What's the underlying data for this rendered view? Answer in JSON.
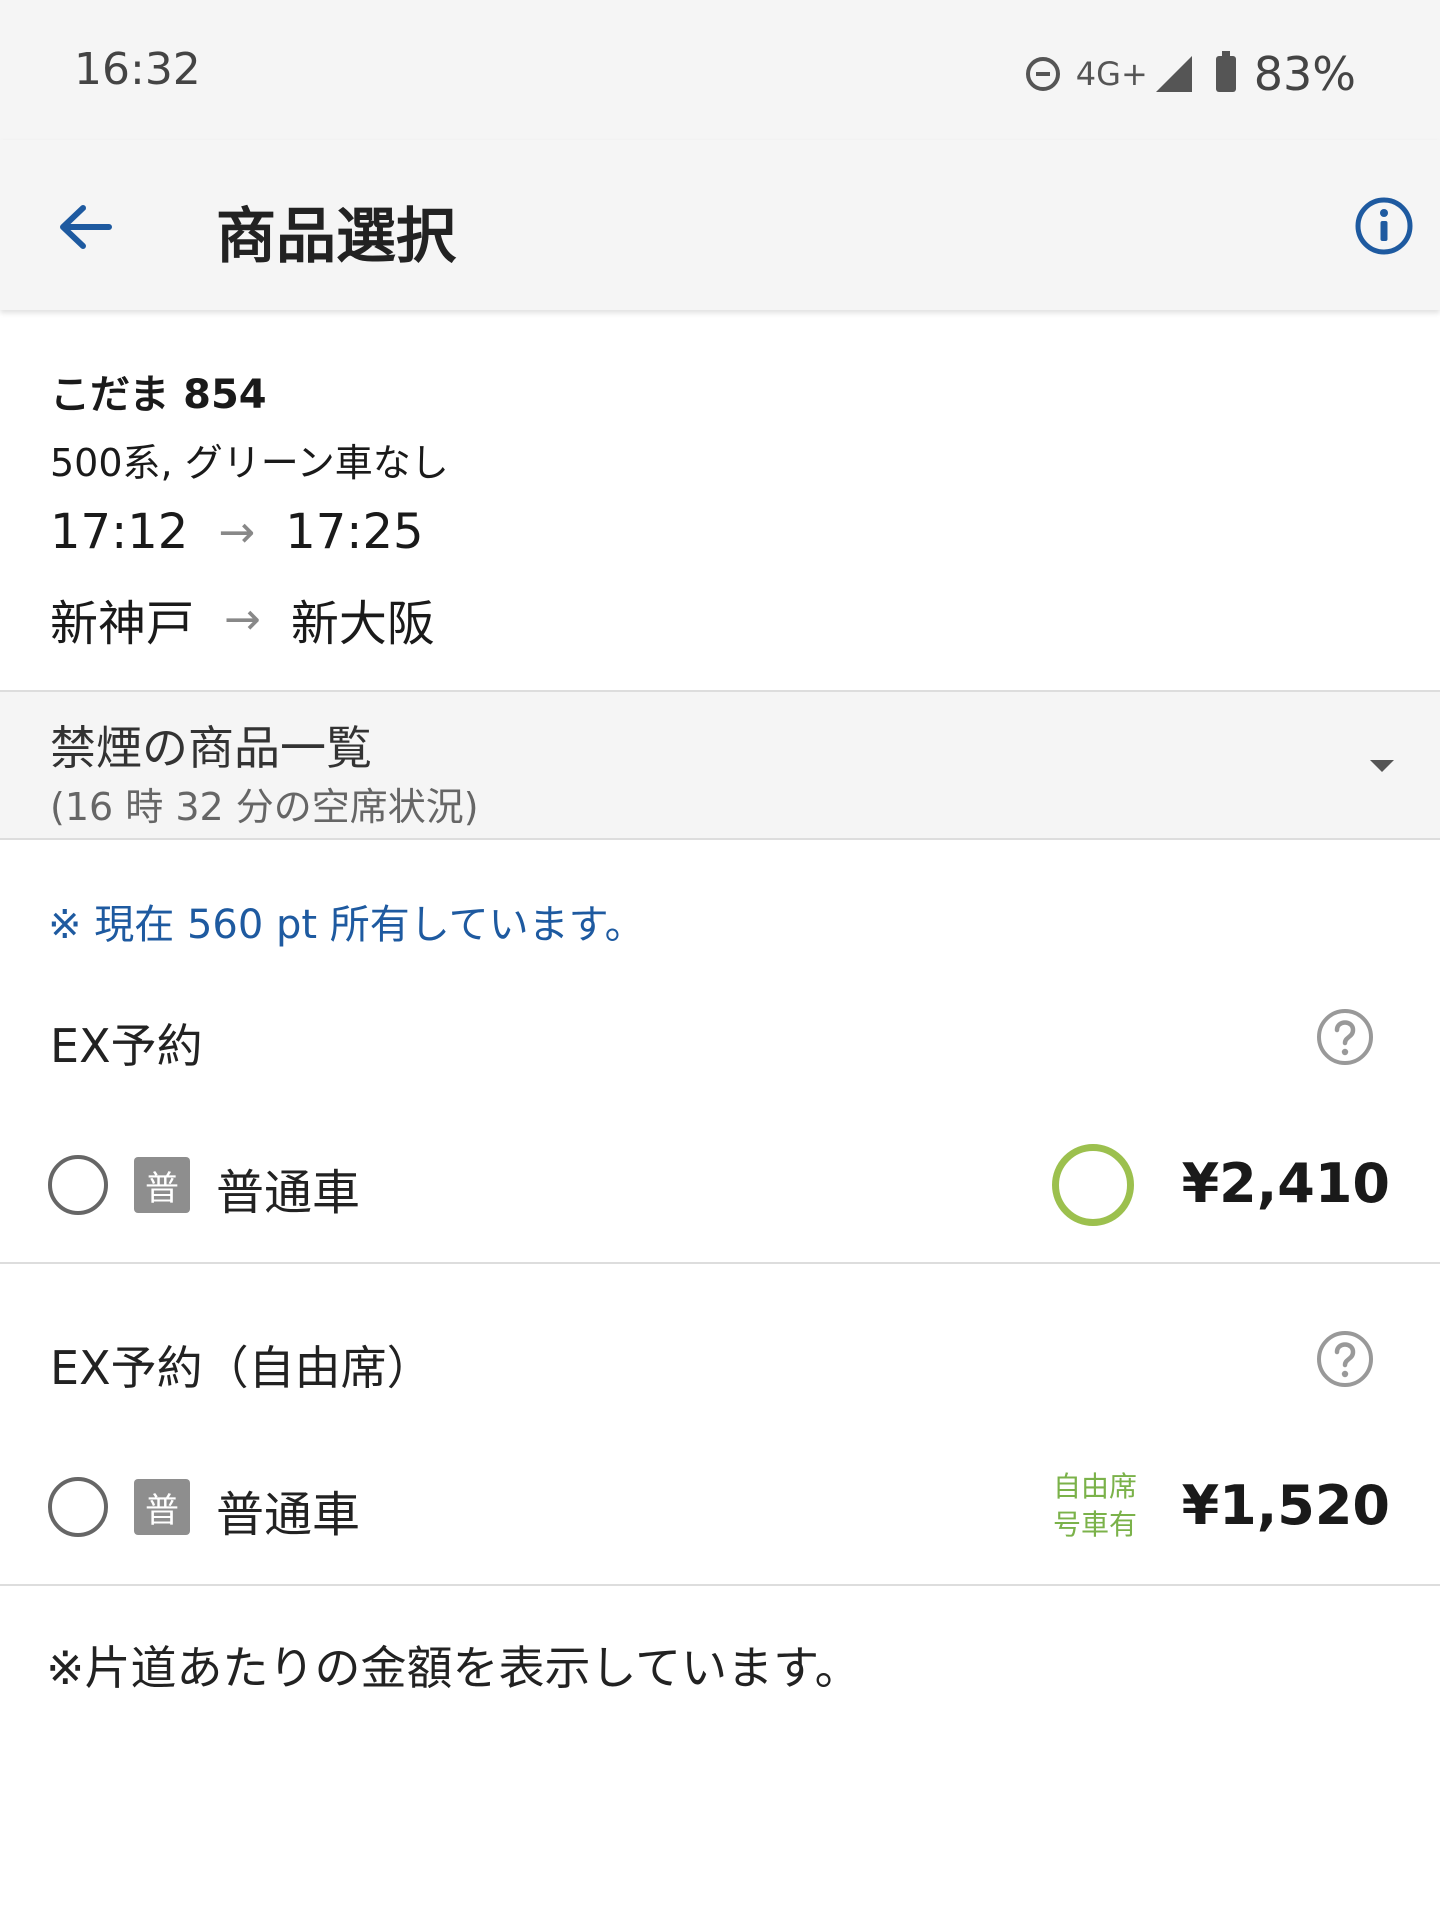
{
  "status_bar": {
    "time": "16:32",
    "network": "4G+",
    "battery": "83%",
    "icons": [
      "do-not-disturb-icon",
      "signal-icon",
      "battery-icon"
    ]
  },
  "app_bar": {
    "title": "商品選択",
    "back_icon": "arrow-back-icon",
    "info_icon": "info-icon"
  },
  "train": {
    "name": "こだま 854",
    "type": "500系, グリーン車なし",
    "departure_time": "17:12",
    "arrival_time": "17:25",
    "from_station": "新神戸",
    "to_station": "新大阪"
  },
  "product_list": {
    "title": "禁煙の商品一覧",
    "subtitle": "(16 時 32 分の空席状況)"
  },
  "points_note": "※ 現在 560 pt 所有しています。",
  "sections": [
    {
      "title": "EX予約",
      "options": [
        {
          "badge": "普",
          "label": "普通車",
          "availability": "circle",
          "price": "¥2,410"
        }
      ]
    },
    {
      "title": "EX予約（自由席）",
      "options": [
        {
          "badge": "普",
          "label": "普通車",
          "availability_line1": "自由席",
          "availability_line2": "号車有",
          "price": "¥1,520"
        }
      ]
    }
  ],
  "footer_note": "※片道あたりの金額を表示しています。",
  "colors": {
    "accent_blue": "#1e5aa0",
    "availability_green": "#9cc04e",
    "badge_gray": "#8e8e8e"
  }
}
